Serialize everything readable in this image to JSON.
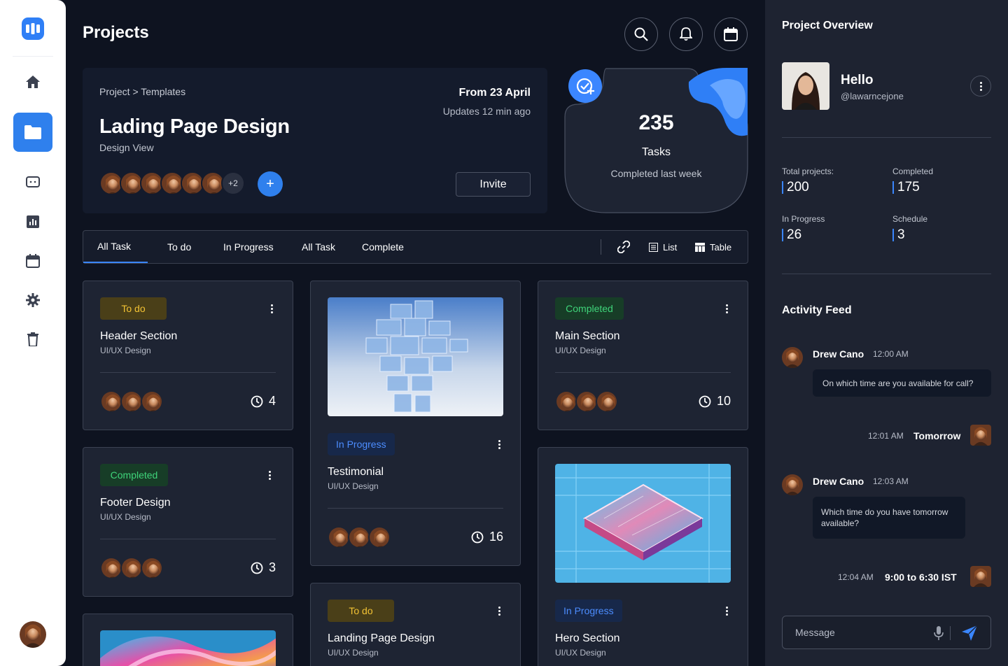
{
  "header": {
    "title": "Projects"
  },
  "project": {
    "breadcrumb": "Project > Templates",
    "date": "From 23 April",
    "updated": "Updates 12 min ago",
    "title": "Lading Page Design",
    "subtitle": "Design View",
    "more_members": "+2",
    "add_label": "+",
    "invite_label": "Invite"
  },
  "stats_blob": {
    "count": "235",
    "label": "Tasks",
    "sub": "Completed last week"
  },
  "tabs": {
    "items": [
      "All Task",
      "To do",
      "In Progress",
      "All Task",
      "Complete"
    ],
    "active_index": 0,
    "list_label": "List",
    "table_label": "Table"
  },
  "cards": [
    {
      "status": "To do",
      "title": "Header Section",
      "category": "UI/UX Design",
      "count": "4"
    },
    {
      "status": "Completed",
      "title": "Footer Design",
      "category": "UI/UX Design",
      "count": "3"
    },
    {
      "status": "In Progress",
      "title": "Testimonial",
      "category": "UI/UX Design",
      "count": "16"
    },
    {
      "status": "To do",
      "title": "Landing Page Design",
      "category": "UI/UX Design"
    },
    {
      "status": "Completed",
      "title": "Main Section",
      "category": "UI/UX Design",
      "count": "10"
    },
    {
      "status": "In Progress",
      "title": "Hero Section",
      "category": "UI/UX Design"
    }
  ],
  "overview": {
    "title": "Project Overview",
    "greeting": "Hello",
    "handle": "@lawarncejone",
    "stats": [
      {
        "label": "Total projects:",
        "value": "200"
      },
      {
        "label": "Completed",
        "value": "175"
      },
      {
        "label": "In Progress",
        "value": "26"
      },
      {
        "label": "Schedule",
        "value": "3"
      }
    ]
  },
  "feed": {
    "title": "Activity Feed",
    "items": [
      {
        "name": "Drew Cano",
        "time": "12:00 AM",
        "message": "On which time are you available for call?"
      },
      {
        "time": "12:01 AM",
        "reply": "Tomorrow"
      },
      {
        "name": "Drew Cano",
        "time": "12:03 AM",
        "message": "Which time do you have tomorrow available?"
      },
      {
        "time": "12:04 AM",
        "reply": "9:00 to 6:30 IST"
      }
    ]
  },
  "message": {
    "placeholder": "Message"
  },
  "colors": {
    "accent": "#2f80ed",
    "background": "#0e1320",
    "panel": "#1e2331",
    "todo": "#f2c234",
    "completed": "#3fd47a",
    "progress": "#4c8dff"
  },
  "icons": [
    "home-icon",
    "folder-icon",
    "chat-icon",
    "chart-icon",
    "calendar-icon",
    "gear-icon",
    "trash-icon",
    "search-icon",
    "bell-icon",
    "link-icon",
    "list-icon",
    "table-icon",
    "clock-icon",
    "mic-icon",
    "send-icon",
    "check-plus-icon"
  ]
}
